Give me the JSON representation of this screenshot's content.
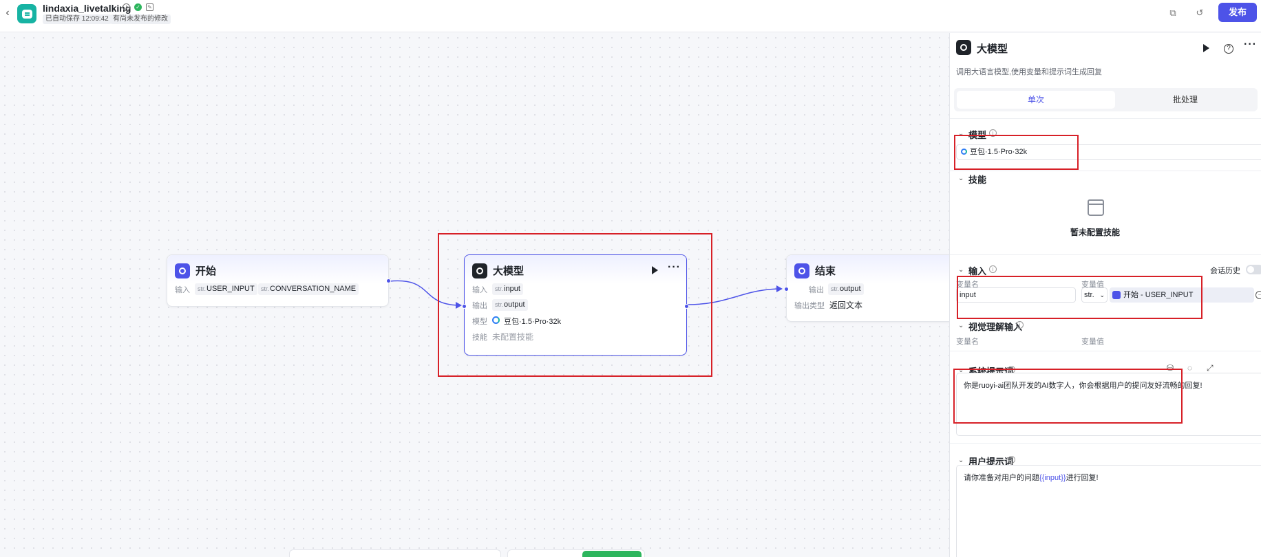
{
  "header": {
    "app_name": "lindaxia_livetalking",
    "autosave": "已自动保存 12:09:42",
    "unpublished": "有尚未发布的修改",
    "publish_label": "发布"
  },
  "nodes": {
    "start": {
      "title": "开始",
      "input_label": "输入",
      "inputs": [
        {
          "prefix": "str.",
          "name": "USER_INPUT"
        },
        {
          "prefix": "str.",
          "name": "CONVERSATION_NAME"
        }
      ]
    },
    "llm": {
      "title": "大模型",
      "input_label": "输入",
      "input_prefix": "str.",
      "input_name": "input",
      "output_label": "输出",
      "output_prefix": "str.",
      "output_name": "output",
      "model_label": "模型",
      "model_name": "豆包·1.5·Pro·32k",
      "skill_label": "技能",
      "skill_value": "未配置技能"
    },
    "end": {
      "title": "结束",
      "output_label": "输出",
      "output_prefix": "str.",
      "output_name": "output",
      "output_type_label": "输出类型",
      "output_type_value": "返回文本"
    }
  },
  "panel": {
    "title": "大模型",
    "description": "调用大语言模型,使用变量和提示词生成回复",
    "tabs": [
      "单次",
      "批处理"
    ],
    "model": {
      "section": "模型",
      "selected": "豆包·1.5·Pro·32k"
    },
    "skills": {
      "section": "技能",
      "empty": "暂未配置技能"
    },
    "input": {
      "section": "输入",
      "history_label": "会话历史",
      "col_name": "变量名",
      "col_value": "变量值",
      "var_name": "input",
      "var_type": "str.",
      "var_ref": "开始 - USER_INPUT"
    },
    "vision": {
      "section": "视觉理解输入",
      "col_name": "变量名",
      "col_value": "变量值"
    },
    "system_prompt": {
      "section": "系统提示词",
      "text": "你是ruoyi-ai团队开发的AI数字人，你会根据用户的提问友好流畅的回复!"
    },
    "user_prompt": {
      "section": "用户提示词",
      "text_before": "请你准备对用户的问题",
      "variable": "{{input}}",
      "text_after": "进行回复!"
    }
  },
  "colors": {
    "accent": "#4d53e8",
    "highlight": "#d72027"
  }
}
